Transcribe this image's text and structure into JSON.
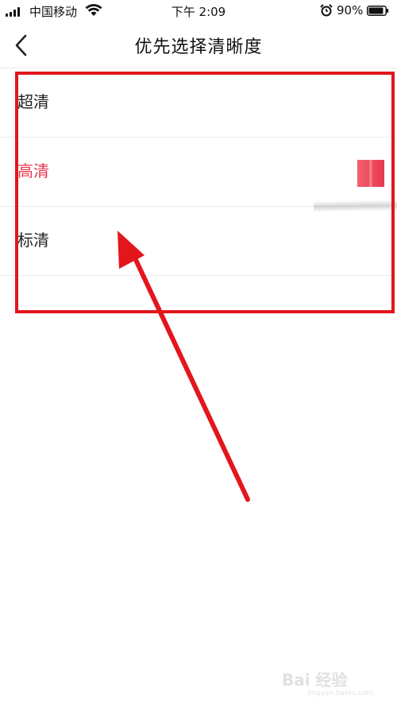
{
  "status_bar": {
    "carrier": "中国移动",
    "time": "下午 2:09",
    "battery_percent": "90%",
    "battery_level": 0.9,
    "icons": [
      "signal-icon",
      "wifi-icon",
      "alarm-icon",
      "battery-icon"
    ]
  },
  "nav": {
    "title": "优先选择清晰度",
    "back_icon": "chevron-left-icon"
  },
  "options": [
    {
      "label": "超清",
      "selected": false
    },
    {
      "label": "高清",
      "selected": true
    },
    {
      "label": "标清",
      "selected": false
    }
  ],
  "colors": {
    "accent": "#e8374f",
    "annotation": "#e3161c",
    "divider": "#ececec"
  },
  "watermark": {
    "text": "Bai 经验",
    "sub": "jingyan.baidu.com"
  }
}
